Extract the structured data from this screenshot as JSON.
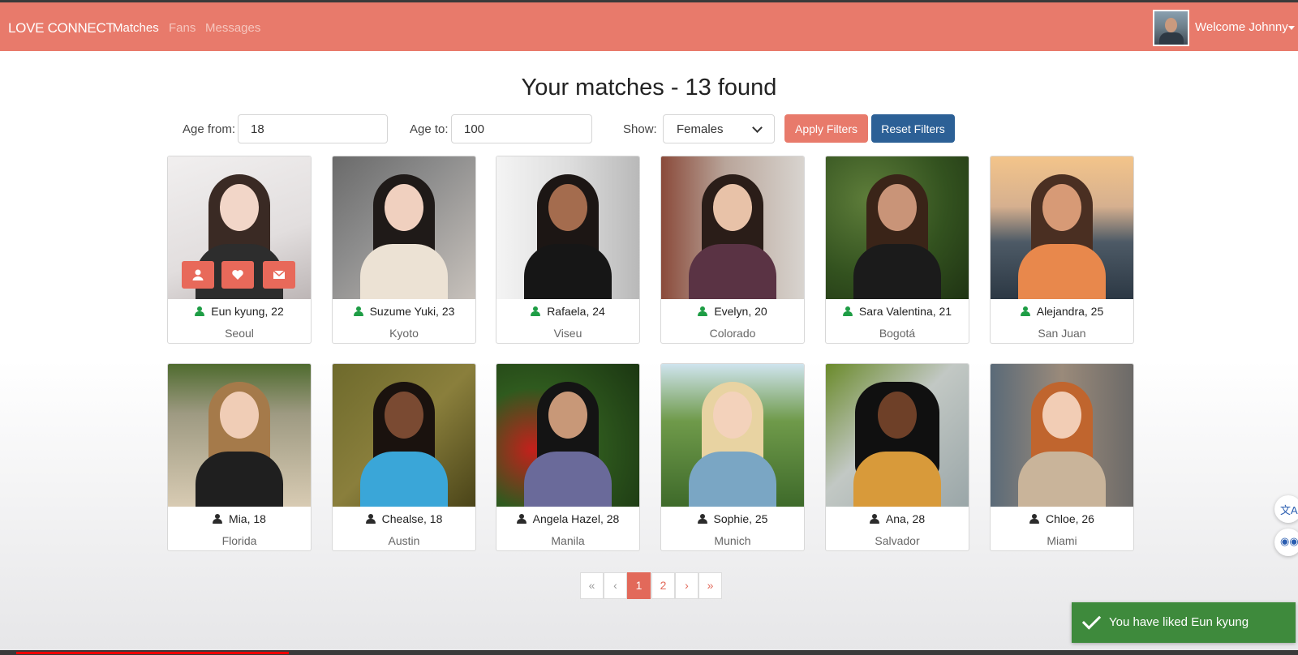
{
  "navbar": {
    "brand": "LOVE CONNECT",
    "links": [
      {
        "label": "Matches",
        "active": true
      },
      {
        "label": "Fans",
        "active": false
      },
      {
        "label": "Messages",
        "active": false
      }
    ],
    "welcome": "Welcome Johnny"
  },
  "page_title": "Your matches - 13 found",
  "filters": {
    "age_from_label": "Age from:",
    "age_from_value": "18",
    "age_to_label": "Age to:",
    "age_to_value": "100",
    "show_label": "Show:",
    "show_value": "Females",
    "apply_label": "Apply Filters",
    "reset_label": "Reset Filters"
  },
  "matches": [
    {
      "name_age": "Eun kyung, 22",
      "city": "Seoul",
      "online": true
    },
    {
      "name_age": "Suzume Yuki, 23",
      "city": "Kyoto",
      "online": true
    },
    {
      "name_age": "Rafaela, 24",
      "city": "Viseu",
      "online": true
    },
    {
      "name_age": "Evelyn, 20",
      "city": "Colorado",
      "online": true
    },
    {
      "name_age": "Sara Valentina, 21",
      "city": "Bogotá",
      "online": true
    },
    {
      "name_age": "Alejandra, 25",
      "city": "San Juan",
      "online": true
    },
    {
      "name_age": "Mia, 18",
      "city": "Florida",
      "online": false
    },
    {
      "name_age": "Chealse, 18",
      "city": "Austin",
      "online": false
    },
    {
      "name_age": "Angela Hazel, 28",
      "city": "Manila",
      "online": false
    },
    {
      "name_age": "Sophie, 25",
      "city": "Munich",
      "online": false
    },
    {
      "name_age": "Ana, 28",
      "city": "Salvador",
      "online": false
    },
    {
      "name_age": "Chloe, 26",
      "city": "Miami",
      "online": false
    }
  ],
  "pagination": {
    "first": "«",
    "prev": "‹",
    "pages": [
      "1",
      "2"
    ],
    "current": "1",
    "next": "›",
    "last": "»"
  },
  "toast": {
    "message": "You have liked Eun kyung"
  },
  "colors": {
    "navbar": "#e87a6b",
    "apply_button": "#e87a6b",
    "reset_button": "#2c6096",
    "online_icon": "#1e9d45",
    "toast": "#3e8a3c"
  },
  "icons": {
    "card_hover_actions": [
      "user-icon",
      "heart-icon",
      "envelope-icon"
    ],
    "floating": [
      "translate-icon",
      "assistant-icon"
    ]
  },
  "video_progress": 0.21
}
